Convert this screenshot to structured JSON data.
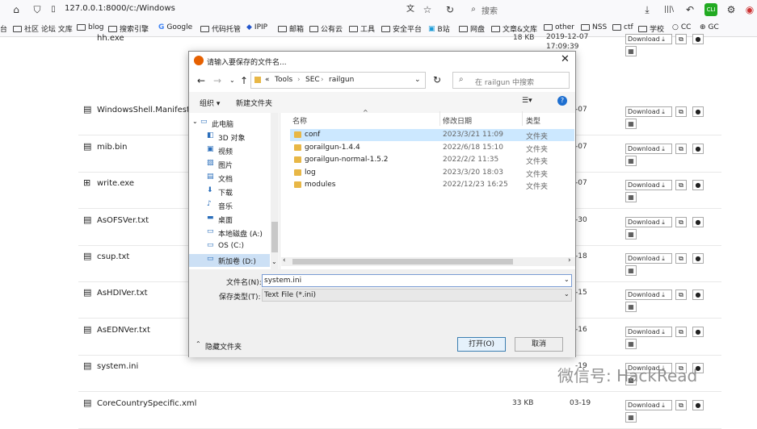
{
  "browser": {
    "url": "127.0.0.1:8000/c:/Windows",
    "search_placeholder": "搜索",
    "bookmarks": [
      "台",
      "社区 论坛 文库",
      "blog",
      "搜索引擎",
      "Google",
      "代码托管",
      "IPIP",
      "邮箱",
      "公有云",
      "工具",
      "安全平台",
      "B站",
      "网盘",
      "文章&文库",
      "other",
      "NSS",
      "ctf",
      "学校",
      "CC",
      "GC"
    ]
  },
  "page": {
    "top_partial": {
      "name": "hh.exe",
      "size": "18 KB",
      "date1": "2019-12-07",
      "date2": "17:09:39"
    },
    "rows": [
      {
        "name": "WindowsShell.Manifest",
        "date": "-07"
      },
      {
        "name": "mib.bin",
        "date": "-07"
      },
      {
        "name": "write.exe",
        "date": "-07"
      },
      {
        "name": "AsOFSVer.txt",
        "date": "-30"
      },
      {
        "name": "csup.txt",
        "date": "-18"
      },
      {
        "name": "AsHDIVer.txt",
        "date": "-15"
      },
      {
        "name": "AsEDNVer.txt",
        "date": "-16"
      },
      {
        "name": "system.ini",
        "date": "-19"
      },
      {
        "name": "CoreCountrySpecific.xml",
        "size": "33 KB",
        "date": "03-19"
      }
    ],
    "download_label": "Download",
    "watermark": "微信号: HackRead"
  },
  "dialog": {
    "title": "请输入要保存的文件名...",
    "breadcrumb": [
      "«",
      "Tools",
      "SEC",
      "railgun"
    ],
    "search_placeholder": "在 railgun 中搜索",
    "organize": "组织 ▾",
    "new_folder": "新建文件夹",
    "tree": [
      "此电脑",
      "3D 对象",
      "视频",
      "图片",
      "文档",
      "下载",
      "音乐",
      "桌面",
      "本地磁盘 (A:)",
      "OS (C:)",
      "新加卷 (D:)"
    ],
    "columns": {
      "name": "名称",
      "date": "修改日期",
      "type": "类型"
    },
    "files": [
      {
        "name": "conf",
        "date": "2023/3/21 11:09",
        "type": "文件夹"
      },
      {
        "name": "gorailgun-1.4.4",
        "date": "2022/6/18 15:10",
        "type": "文件夹"
      },
      {
        "name": "gorailgun-normal-1.5.2",
        "date": "2022/2/2 11:35",
        "type": "文件夹"
      },
      {
        "name": "log",
        "date": "2023/3/20 18:03",
        "type": "文件夹"
      },
      {
        "name": "modules",
        "date": "2022/12/23 16:25",
        "type": "文件夹"
      }
    ],
    "filename_label": "文件名(N):",
    "filename_value": "system.ini",
    "filetype_label": "保存类型(T):",
    "filetype_value": "Text File (*.ini)",
    "hide_folders": "隐藏文件夹",
    "open": "打开(O)",
    "cancel": "取消"
  }
}
